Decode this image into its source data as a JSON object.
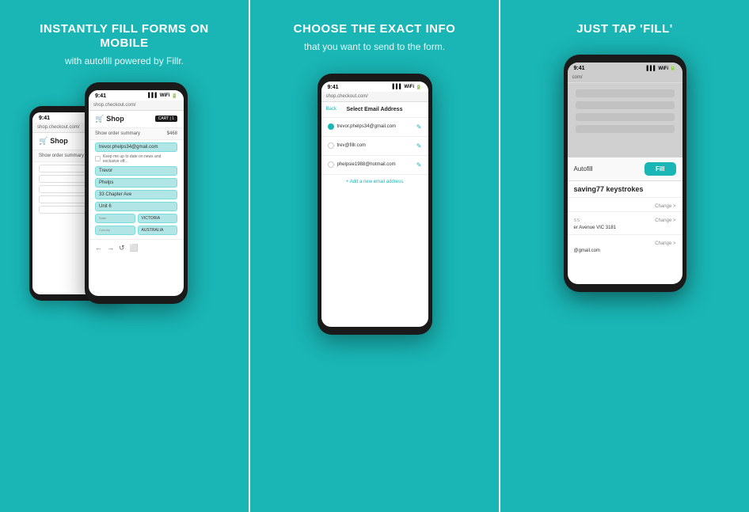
{
  "panels": [
    {
      "title": "INSTANTLY FILL FORMS ON MOBILE",
      "subtitle": "with autofill powered by Fillr.",
      "id": "panel-1"
    },
    {
      "title": "CHOOSE THE EXACT INFO",
      "subtitle": "that you want to send to the form.",
      "id": "panel-2"
    },
    {
      "title": "JUST TAP 'FILL'",
      "subtitle": "",
      "id": "panel-3"
    }
  ],
  "phone1": {
    "time": "9:41",
    "url": "shop.checkout.com/",
    "shopTitle": "Shop",
    "cartLabel": "CART | 1",
    "orderSummary": "Show order summary",
    "orderPrice": "$468",
    "emailField": "trevor.phelps34@gmail.com",
    "checkboxText": "Keep me up to date on news and exclusive off...",
    "fields": [
      "Trevor",
      "Phelps",
      "33 Chapter Ave",
      "Unit 6"
    ],
    "stateField": "VICTORIA",
    "countryField": "AUSTRALIA"
  },
  "phone2": {
    "time": "9:41",
    "url": "shop.checkout.com/",
    "backLabel": "Back",
    "selectTitle": "Select Email Address",
    "emails": [
      {
        "address": "trevor.phelps34@gmail.com",
        "selected": true
      },
      {
        "address": "trev@fillr.com",
        "selected": false
      },
      {
        "address": "phelpsie1988@hotmail.com",
        "selected": false
      }
    ],
    "addEmail": "+ Add a new email address"
  },
  "phone3": {
    "time": "9:41",
    "urlPartial": "com/",
    "autofillLabel": "Autofill",
    "fillButton": "Fill",
    "savingText": "saving",
    "keystrokeCount": "77",
    "keystrokeSuffix": " keystrokes",
    "rows": [
      {
        "label": "",
        "value": "",
        "change": "Change >"
      },
      {
        "label": "SS",
        "value": "er Avenue VIC 3181",
        "change": "Change >"
      },
      {
        "label": "",
        "value": "@gmail.com",
        "change": "Change >"
      }
    ]
  }
}
